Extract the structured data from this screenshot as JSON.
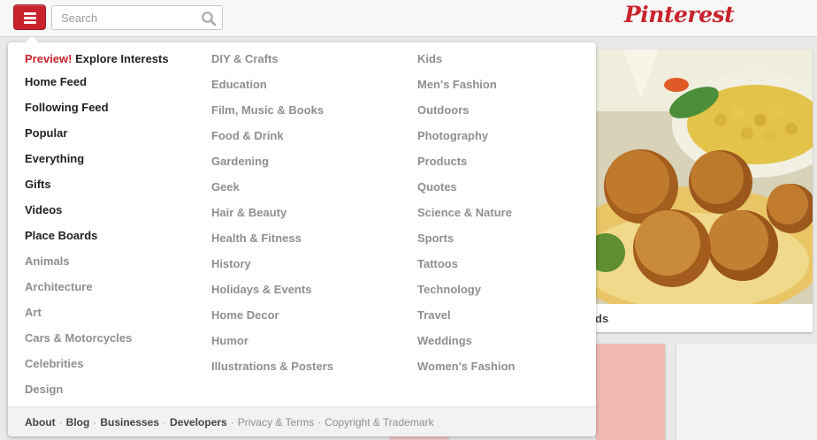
{
  "header": {
    "search_placeholder": "Search",
    "logo_text": "Pinterest",
    "brand_color": "#c8232c"
  },
  "pin": {
    "caption": "ds"
  },
  "menu": {
    "preview_label": "Preview!",
    "explore_label": "Explore Interests",
    "column1": [
      "Home Feed",
      "Following Feed",
      "Popular",
      "Everything",
      "Gifts",
      "Videos",
      "Place Boards",
      "Animals",
      "Architecture",
      "Art",
      "Cars & Motorcycles",
      "Celebrities",
      "Design"
    ],
    "column2": [
      "DIY & Crafts",
      "Education",
      "Film, Music & Books",
      "Food & Drink",
      "Gardening",
      "Geek",
      "Hair & Beauty",
      "Health & Fitness",
      "History",
      "Holidays & Events",
      "Home Decor",
      "Humor",
      "Illustrations & Posters"
    ],
    "column3": [
      "Kids",
      "Men's Fashion",
      "Outdoors",
      "Photography",
      "Products",
      "Quotes",
      "Science & Nature",
      "Sports",
      "Tattoos",
      "Technology",
      "Travel",
      "Weddings",
      "Women's Fashion"
    ]
  },
  "footer": {
    "about": "About",
    "blog": "Blog",
    "businesses": "Businesses",
    "developers": "Developers",
    "privacy": "Privacy & Terms",
    "copyright": "Copyright & Trademark",
    "separator": "·"
  }
}
